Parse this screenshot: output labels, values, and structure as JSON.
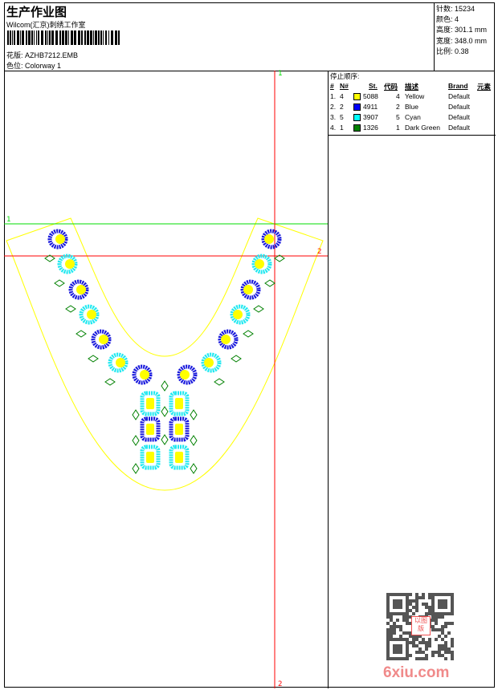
{
  "header": {
    "title": "生产作业图",
    "subtitle": "Wilcom(汇京)刺绣工作室",
    "design_label": "花版:",
    "design_value": "AZHB7212.EMB",
    "colorway_label": "色位:",
    "colorway_value": "Colorway 1"
  },
  "stats": [
    {
      "label": "针数:",
      "value": "15234"
    },
    {
      "label": "颜色:",
      "value": "4"
    },
    {
      "label": "高度:",
      "value": "301.1 mm"
    },
    {
      "label": "宽度:",
      "value": "348.0 mm"
    },
    {
      "label": "比例:",
      "value": "0.38"
    }
  ],
  "stop_sequence": {
    "title": "停止顺序:",
    "headers": {
      "num": "#",
      "n": "N#",
      "st": "St.",
      "code": "代码",
      "desc": "描述",
      "brand": "Brand",
      "elem": "元素"
    },
    "rows": [
      {
        "num": "1.",
        "n": "4",
        "color": "#ffff00",
        "st": "5088",
        "code": "4",
        "desc": "Yellow",
        "brand": "Default"
      },
      {
        "num": "2.",
        "n": "2",
        "color": "#0000ff",
        "st": "4911",
        "code": "2",
        "desc": "Blue",
        "brand": "Default"
      },
      {
        "num": "3.",
        "n": "5",
        "color": "#00ffff",
        "st": "3907",
        "code": "5",
        "desc": "Cyan",
        "brand": "Default"
      },
      {
        "num": "4.",
        "n": "1",
        "color": "#008000",
        "st": "1326",
        "code": "1",
        "desc": "Dark Green",
        "brand": "Default"
      }
    ]
  },
  "guides": {
    "v_top": "1",
    "v_bottom": "2",
    "h1": "1",
    "h2": "2"
  },
  "colors": {
    "outline": "#ffff00",
    "blue": "#1a1adc",
    "cyan": "#22e8f0",
    "yellow": "#ffff00",
    "green": "#008000",
    "guide_red": "#ff0000",
    "guide_green": "#00dd00"
  },
  "watermark": "6xiu.com",
  "stamp": "以图版"
}
